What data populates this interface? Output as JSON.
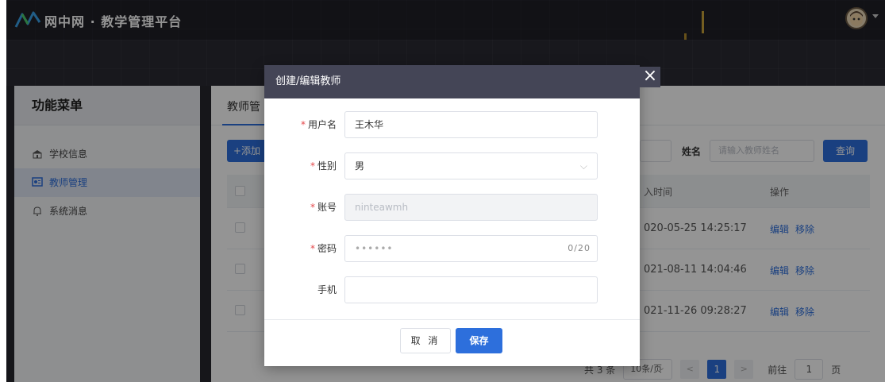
{
  "header": {
    "brand": "网中网 · 教学管理平台",
    "logo_icon": "zigzag-logo-icon",
    "avatar_icon": "user-avatar-icon"
  },
  "sidebar": {
    "title": "功能菜单",
    "items": [
      {
        "label": "学校信息",
        "icon": "school-building-icon",
        "active": false
      },
      {
        "label": "教师管理",
        "icon": "teacher-board-icon",
        "active": true
      },
      {
        "label": "系统消息",
        "icon": "bell-icon",
        "active": false
      }
    ]
  },
  "main": {
    "tab_label": "教师管",
    "add_button": "+添加",
    "filter": {
      "name_label": "姓名",
      "name_placeholder": "请输入教师姓名",
      "search_button": "查询"
    },
    "table": {
      "headers": {
        "time": "入时间",
        "ops": "操作"
      },
      "rows": [
        {
          "time": "020-05-25 14:25:17",
          "edit": "编辑",
          "remove": "移除"
        },
        {
          "time": "021-08-11 14:04:46",
          "edit": "编辑",
          "remove": "移除"
        },
        {
          "time": "021-11-26 09:28:27",
          "edit": "编辑",
          "remove": "移除"
        }
      ]
    },
    "pager": {
      "total": "共 3 条",
      "page_size": "10条/页",
      "prev": "<",
      "current": "1",
      "next": ">",
      "goto_label": "前往",
      "goto_value": "1",
      "page_unit": "页"
    }
  },
  "modal": {
    "title": "创建/编辑教师",
    "close": "×",
    "fields": {
      "username": {
        "label": "用户名",
        "value": "王木华"
      },
      "gender": {
        "label": "性别",
        "value": "男"
      },
      "account": {
        "label": "账号",
        "value": "ninteawmh"
      },
      "password": {
        "label": "密码",
        "value": "••••••",
        "count": "0/20"
      },
      "phone": {
        "label": "手机",
        "value": ""
      }
    },
    "required_mark": "*",
    "cancel_button": "取 消",
    "save_button": "保存"
  },
  "colors": {
    "accent": "#2d6fdc",
    "header_bg": "#1f1f26",
    "modal_header_bg": "#444556",
    "required": "#e4484b"
  }
}
